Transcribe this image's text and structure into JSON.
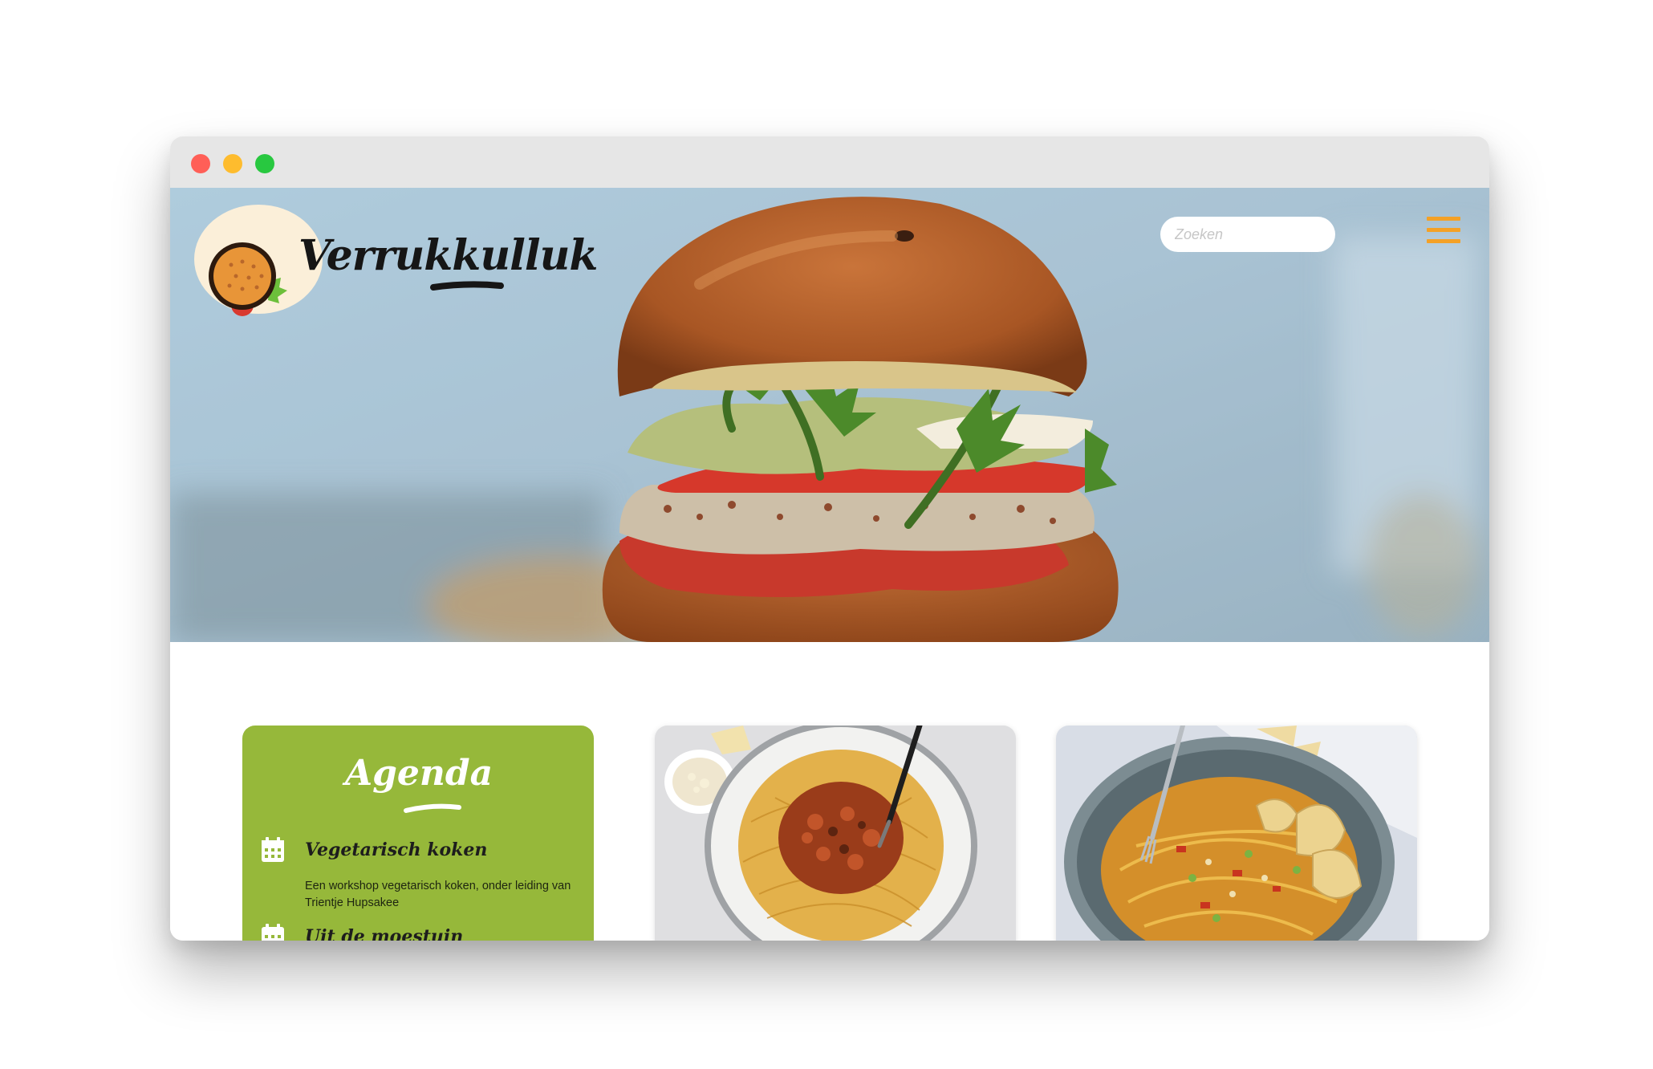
{
  "window": {
    "controls": [
      "close",
      "minimize",
      "maximize"
    ],
    "control_colors": {
      "close": "#ff5f57",
      "minimize": "#febc2e",
      "maximize": "#28c840"
    }
  },
  "header": {
    "logo_text": "Verrukkulluk",
    "logo_icon": "burger-icon",
    "search_placeholder": "Zoeken",
    "menu_icon": "hamburger-menu-icon",
    "accent_color": "#f4a126"
  },
  "hero": {
    "image": "veggie-burger-photo"
  },
  "agenda": {
    "title": "Agenda",
    "background_color": "#96b83a",
    "items": [
      {
        "icon": "calendar-icon",
        "title": "Vegetarisch koken",
        "description": "Een workshop vegetarisch koken, onder leiding van Trientje Hupsakee"
      },
      {
        "icon": "calendar-icon",
        "title": "Uit de moestuin",
        "description": ""
      }
    ]
  },
  "recipe_cards": [
    {
      "image": "spaghetti-bolognese-photo"
    },
    {
      "image": "noodle-bowl-photo"
    }
  ]
}
